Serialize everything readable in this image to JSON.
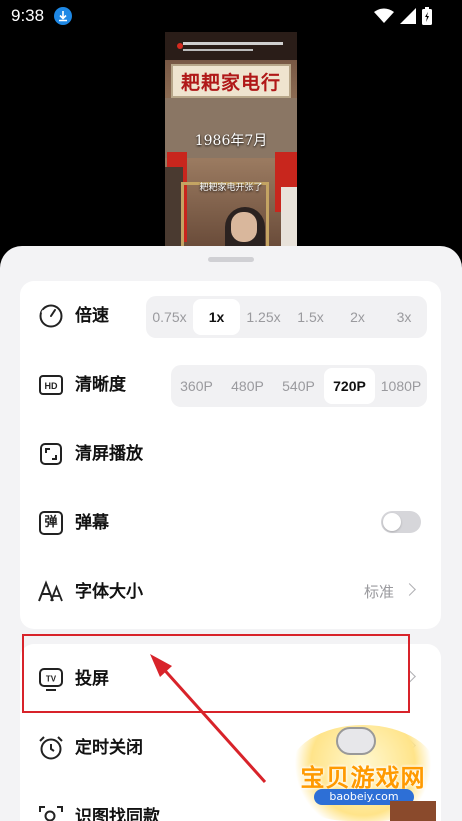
{
  "status_bar": {
    "time": "9:38",
    "download_icon": "download-arrow-icon",
    "signal_icons": [
      "wifi-icon",
      "cell-signal-icon",
      "battery-charging-icon"
    ]
  },
  "video": {
    "sign": "耙耙家电行",
    "date": "1986年7月",
    "subtitle": "耙耙家电开张了"
  },
  "panel": {
    "speed": {
      "label": "倍速",
      "icon": "speed-dial-icon",
      "options": [
        "0.75x",
        "1x",
        "1.25x",
        "1.5x",
        "2x",
        "3x"
      ],
      "selected": "1x"
    },
    "quality": {
      "label": "清晰度",
      "icon": "hd-icon",
      "options": [
        "360P",
        "480P",
        "540P",
        "720P",
        "1080P"
      ],
      "selected": "720P"
    },
    "clear_screen": {
      "label": "清屏播放",
      "icon": "clear-screen-icon"
    },
    "danmaku": {
      "label": "弹幕",
      "icon": "danmaku-icon",
      "icon_char": "弹",
      "enabled": false
    },
    "font_size": {
      "label": "字体大小",
      "icon": "font-size-icon",
      "value": "标准"
    },
    "cast": {
      "label": "投屏",
      "icon": "tv-cast-icon"
    },
    "timer": {
      "label": "定时关闭",
      "icon": "alarm-clock-icon"
    },
    "image_search": {
      "label": "识图找同款",
      "icon": "image-search-icon"
    }
  },
  "watermark": {
    "text": "宝贝游戏网",
    "url": "baobeiy.com"
  },
  "colors": {
    "highlight_red": "#d8232a",
    "sheet_bg": "#f3f3f5",
    "accent_blue": "#1e88e5"
  }
}
